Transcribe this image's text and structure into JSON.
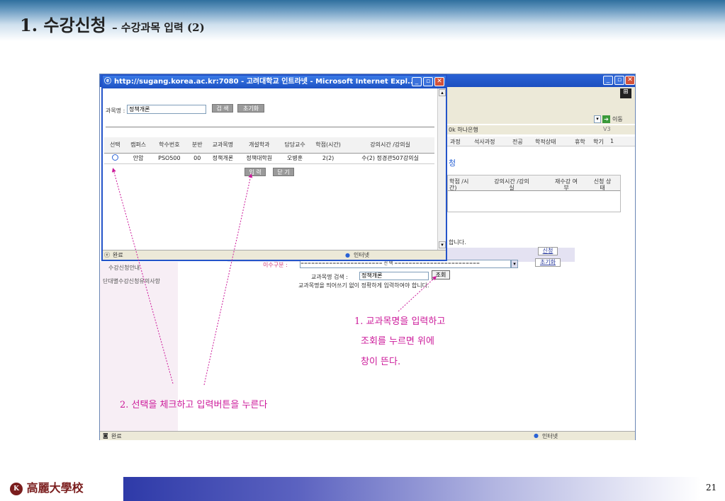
{
  "header": {
    "title": "1. 수강신청",
    "subtitle": "– 수강과목 입력 (2)"
  },
  "popup": {
    "window_title": "http://sugang.korea.ac.kr:7080 - 고려대학교 인트라넷 - Microsoft Internet Expl...",
    "course_name_label": "과목명 :",
    "course_name_value": "정책개론",
    "search_button": "검 색",
    "reset_button": "초기화",
    "columns": [
      "선택",
      "캠퍼스",
      "학수번호",
      "분반",
      "교과목명",
      "개설학과",
      "담당교수",
      "학점(시간)",
      "강의시간 /강의실"
    ],
    "rows": [
      [
        "",
        "안암",
        "PSO500",
        "00",
        "정책개론",
        "정책대학원",
        "오병훈",
        "2(2)",
        "수(2) 정경관507강의실"
      ]
    ],
    "input_button": "입 력",
    "close_button": "닫 기",
    "status_done": "완료",
    "status_zone": "인터넷"
  },
  "background_window": {
    "address_go": "이동",
    "links_bar": "0k 하나은행",
    "v3_label": "V3",
    "nav_tabs": [
      "과정",
      "석사과정",
      "전공",
      "학적상태",
      "휴학",
      "학기",
      "1"
    ],
    "section_char": "청",
    "table_headers": [
      "학점 /시간)",
      "강의시간 /강의실",
      "재수강 여부",
      "신청 상태"
    ],
    "notice_text": "합니다.",
    "apply_button": "신청",
    "reset_button": "초기화",
    "sidebar_items": [
      "수강신청안내",
      "단대별수강신청유의사항"
    ],
    "category_label": "이수구분 :",
    "category_select": "======================= 선 택 ========================",
    "search_label": "교과목명 검색 :",
    "search_value": "정책개론",
    "lookup_button": "조회",
    "hint": "교과목명을 띄어쓰기 없이 정확하게 입력하여야 합니다.",
    "status_done": "완료",
    "status_zone": "인터넷"
  },
  "annotations": {
    "note1_line1": "1. 교과목명을 입력하고",
    "note1_line2": "조회를 누르면 위에",
    "note1_line3": "창이 뜬다.",
    "note2": "2. 선택을 체크하고 입력버튼을 누른다"
  },
  "footer": {
    "logo_text": "高麗大學校",
    "page_number": "21"
  }
}
